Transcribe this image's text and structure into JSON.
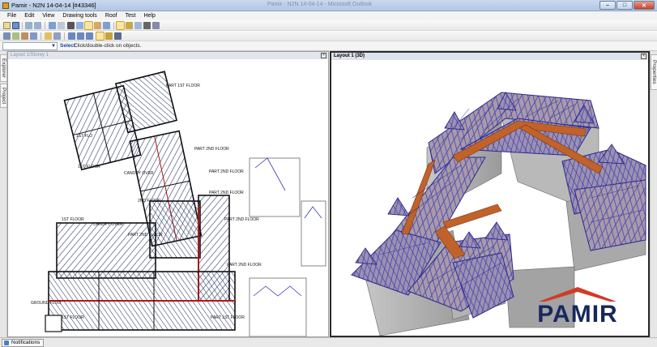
{
  "window": {
    "title": "Pamir - N2N 14-04-14      [#43346]",
    "ghost_title": "Pamir - N2N 14-04-14 - Microsoft Outlook",
    "minimize": "–",
    "maximize": "□",
    "close": "✕"
  },
  "menu": [
    "File",
    "Edit",
    "View",
    "Drawing tools",
    "Roof",
    "Test",
    "Help"
  ],
  "command": {
    "label": "Select",
    "message": "Click/double-click on objects."
  },
  "side_tabs": {
    "explorer": "Explorer",
    "project": "Project",
    "properties": "Properties"
  },
  "panels": {
    "plan_title": "Layout 1/Storey 1",
    "view3d_title": "Layout 1 (3D)",
    "close_glyph": "×"
  },
  "plan_labels": {
    "part_1st_floor": "PART 1ST FLOOR",
    "first_floor_a": "1ST FLO",
    "first_floor_b": "1ST FLOOR",
    "part_2nd_floor_a": "PART 2ND FLOOR",
    "part_2nd_floor_b": "PART 2ND FLOOR",
    "canopy_over_a": "CANOPY OVER",
    "second_floor": "2ND FLOOR",
    "part_2nd_floor_c": "PART 2ND FLOOR",
    "first_floor_c": "1ST FLOOR",
    "canopy_over_b": "CANOPY OVER",
    "part_2nd_floor_d": "PART 2ND FLOOR",
    "part_2nd_floor_e": "PART 2ND FLOOR",
    "part_2nd_floor_f": "PART 2ND FLOOR",
    "ground_floor": "GROUND FLOO",
    "first_floor_d": "1ST FLOOR",
    "part_1st_floor_b": "PART 1ST FLOOR"
  },
  "logo": {
    "text": "PAMIR",
    "roof_color": "#d23a25",
    "text_color": "#17285e"
  },
  "colors": {
    "frame": "#3a38b8",
    "beam": "#c0622a",
    "wall": "#b7b7b7",
    "wall_dark": "#8f8f8f"
  },
  "status": {
    "notifications": "Notifications"
  }
}
